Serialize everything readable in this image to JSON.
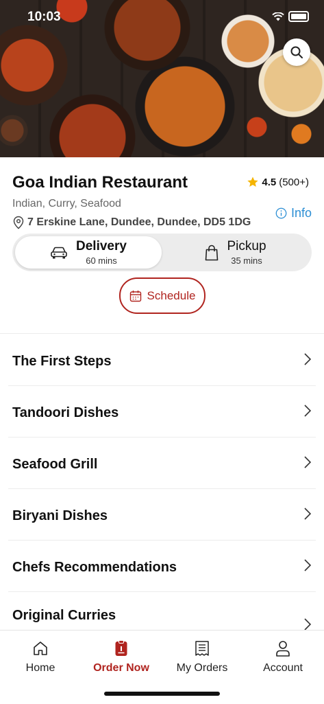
{
  "status": {
    "time": "10:03"
  },
  "restaurant": {
    "name": "Goa Indian Restaurant",
    "rating": "4.5",
    "rating_count": "(500+)",
    "cuisine": "Indian, Curry, Seafood",
    "address": "7 Erskine Lane, Dundee, Dundee, DD5 1DG",
    "info_label": "Info"
  },
  "order_mode": {
    "delivery": {
      "title": "Delivery",
      "time": "60 mins"
    },
    "pickup": {
      "title": "Pickup",
      "time": "35 mins"
    },
    "selected": "delivery"
  },
  "schedule_label": "Schedule",
  "menu": [
    {
      "label": "The First Steps"
    },
    {
      "label": "Tandoori Dishes"
    },
    {
      "label": "Seafood Grill"
    },
    {
      "label": "Biryani Dishes"
    },
    {
      "label": "Chefs Recommendations"
    },
    {
      "label": "Original Curries"
    }
  ],
  "tabs": [
    {
      "label": "Home",
      "icon": "home-icon"
    },
    {
      "label": "Order Now",
      "icon": "order-icon",
      "active": true
    },
    {
      "label": "My Orders",
      "icon": "receipt-icon"
    },
    {
      "label": "Account",
      "icon": "user-icon"
    }
  ],
  "colors": {
    "accent": "#b0241f",
    "link": "#2b8ed4",
    "star": "#f5b400"
  }
}
